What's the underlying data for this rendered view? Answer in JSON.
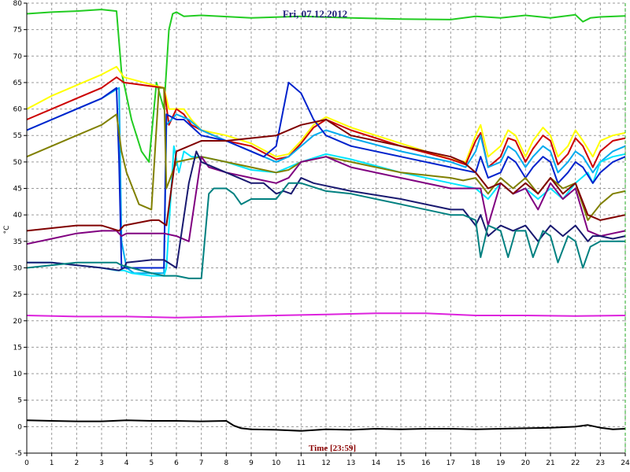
{
  "chart_data": {
    "type": "line",
    "title": "Fri, 07.12.2012",
    "xlabel": "Time [23:59]",
    "ylabel": "°C",
    "xlim": [
      0,
      24
    ],
    "ylim": [
      -5,
      80
    ],
    "x_ticks": [
      0,
      1,
      2,
      3,
      4,
      5,
      6,
      7,
      8,
      9,
      10,
      11,
      12,
      13,
      14,
      15,
      16,
      17,
      18,
      19,
      20,
      21,
      22,
      23,
      24
    ],
    "y_ticks": [
      -5,
      0,
      5,
      10,
      15,
      20,
      25,
      30,
      35,
      40,
      45,
      50,
      55,
      60,
      65,
      70,
      75,
      80
    ],
    "grid": true,
    "series": [
      {
        "color": "#22cc22",
        "x": [
          0,
          1,
          2,
          3,
          3.6,
          3.8,
          4.2,
          4.6,
          4.9,
          5.2,
          5.5,
          5.7,
          5.85,
          6,
          6.3,
          7,
          9,
          11,
          13,
          15,
          17,
          18,
          19,
          20,
          21,
          22,
          22.3,
          22.6,
          23,
          24
        ],
        "y": [
          78,
          78.3,
          78.5,
          78.8,
          78.5,
          67,
          58,
          52,
          50,
          65,
          60,
          75,
          78,
          78.3,
          77.5,
          77.7,
          77.2,
          77.5,
          77.2,
          77,
          76.9,
          77.5,
          77.2,
          77.7,
          77.2,
          77.8,
          76.5,
          77.2,
          77.4,
          77.6
        ]
      },
      {
        "color": "#ffff00",
        "x": [
          0,
          1,
          2,
          3,
          3.6,
          3.9,
          5.5,
          5.7,
          6,
          6.3,
          6.6,
          7,
          8,
          9,
          10,
          10.5,
          11,
          11.5,
          12,
          13,
          15,
          17,
          17.6,
          18,
          18.2,
          18.5,
          19,
          19.3,
          19.6,
          20,
          20.3,
          20.7,
          21,
          21.3,
          21.7,
          22,
          22.3,
          22.7,
          23,
          23.5,
          24
        ],
        "y": [
          60,
          62.5,
          64.5,
          66.5,
          68,
          66,
          64,
          60,
          60,
          60,
          58,
          56,
          55,
          53.5,
          51,
          51.5,
          54,
          57,
          58.5,
          56.5,
          53.5,
          50.5,
          50,
          55,
          57,
          51,
          53,
          56,
          55,
          51,
          54,
          56.5,
          55,
          51,
          53,
          56,
          54,
          51,
          54,
          55,
          55.5
        ]
      },
      {
        "color": "#cc0000",
        "x": [
          0,
          1,
          2,
          3,
          3.6,
          3.9,
          5.5,
          5.7,
          6,
          6.3,
          6.6,
          7,
          8,
          9,
          10,
          10.5,
          11,
          11.5,
          12,
          13,
          15,
          17,
          17.6,
          18,
          18.2,
          18.5,
          19,
          19.3,
          19.6,
          20,
          20.3,
          20.7,
          21,
          21.3,
          21.7,
          22,
          22.3,
          22.7,
          23,
          23.5,
          24
        ],
        "y": [
          58,
          60,
          62,
          64,
          66,
          65,
          64,
          57,
          60,
          59,
          57,
          56,
          54,
          53,
          50.5,
          51,
          53.5,
          56.5,
          58,
          56,
          53,
          50.5,
          49.5,
          54,
          55.5,
          49,
          51,
          54.5,
          54,
          50,
          52.5,
          55,
          54,
          49.5,
          51.5,
          54.5,
          53,
          49,
          52,
          54,
          54.5
        ]
      },
      {
        "color": "#00aaee",
        "x": [
          0,
          1,
          2,
          3,
          3.7,
          3.8,
          4,
          4.3,
          5,
          5.5,
          5.6,
          6,
          6.5,
          7,
          8,
          9,
          10,
          10.5,
          11,
          11.5,
          12,
          13,
          15,
          17,
          17.6,
          18,
          18.2,
          18.5,
          19,
          19.3,
          19.6,
          20,
          20.3,
          20.7,
          21,
          21.3,
          21.7,
          22,
          22.3,
          22.7,
          23,
          23.5,
          24
        ],
        "y": [
          56,
          58,
          60,
          62,
          64,
          35,
          30,
          29,
          29,
          29,
          57,
          59,
          58,
          56,
          54,
          52,
          50,
          51,
          53,
          55,
          56,
          54.5,
          52,
          50,
          49,
          52,
          55,
          49,
          50,
          53,
          52,
          49,
          51,
          53,
          52,
          48,
          50,
          52,
          51,
          48,
          50,
          52,
          53
        ]
      },
      {
        "color": "#00e5ff",
        "x": [
          0,
          1,
          2,
          3,
          3.6,
          3.9,
          4.2,
          5,
          5.5,
          5.6,
          5.9,
          6.1,
          6.3,
          6.6,
          7,
          8,
          9,
          10,
          11,
          12,
          13,
          15,
          17,
          18,
          18.5,
          19,
          19.5,
          20,
          20.5,
          21,
          21.5,
          22,
          22.5,
          22.7,
          23,
          23.5,
          24
        ],
        "y": [
          31,
          31,
          30.5,
          30,
          29.5,
          29.5,
          29,
          28.5,
          28.5,
          30,
          53,
          48,
          52,
          51,
          51,
          50,
          48.5,
          48,
          50,
          51.5,
          50.5,
          48,
          46,
          45,
          43,
          46,
          44,
          45,
          43,
          45,
          43,
          46,
          48,
          46,
          50,
          51,
          51.5
        ]
      },
      {
        "color": "#0022cc",
        "x": [
          0,
          1,
          2,
          3,
          3.6,
          3.7,
          3.8,
          5.5,
          5.6,
          6,
          6.3,
          7,
          8,
          9,
          9.5,
          10,
          10.5,
          11,
          11.5,
          12,
          13,
          15,
          17,
          18,
          18.2,
          18.5,
          19,
          19.3,
          19.6,
          20,
          20.3,
          20.7,
          21,
          21.3,
          21.7,
          22,
          22.3,
          22.7,
          23,
          23.5,
          24
        ],
        "y": [
          56,
          58,
          60,
          62,
          64,
          50,
          30,
          30,
          59,
          58,
          58,
          55,
          54,
          52,
          51,
          53,
          65,
          63,
          58,
          55,
          53,
          51,
          49,
          48,
          51,
          47,
          48,
          51,
          50,
          47,
          49,
          51,
          50,
          46,
          48,
          50,
          49,
          46,
          48,
          50,
          51
        ]
      },
      {
        "color": "#808000",
        "x": [
          0,
          1,
          2,
          3,
          3.6,
          3.8,
          4,
          4.5,
          5,
          5.3,
          5.5,
          5.6,
          6,
          7,
          8,
          9,
          10,
          10.5,
          11,
          12,
          13,
          15,
          17,
          17.5,
          18,
          18.5,
          19,
          19.5,
          20,
          20.5,
          21,
          21.5,
          22,
          22.5,
          23,
          23.5,
          24
        ],
        "y": [
          51,
          53,
          55,
          57,
          59,
          52,
          48,
          42,
          41,
          64,
          64,
          45,
          50,
          51,
          50,
          49,
          48,
          48.5,
          50,
          51,
          50,
          48,
          47,
          46.5,
          47,
          44,
          47,
          45,
          47,
          44,
          47,
          45,
          46,
          39,
          42,
          44,
          44.5
        ]
      },
      {
        "color": "#800080",
        "x": [
          0,
          1,
          2,
          3,
          3.6,
          3.8,
          4,
          5,
          5.5,
          6,
          6.5,
          7,
          7.3,
          8,
          9,
          10,
          10.5,
          11,
          12,
          13,
          15,
          17,
          17.8,
          18.2,
          18.5,
          19,
          19.5,
          20,
          20.5,
          21,
          21.5,
          22,
          22.5,
          23,
          23.5,
          24
        ],
        "y": [
          34.5,
          35.5,
          36.5,
          37,
          37,
          36,
          36.5,
          36.5,
          36.5,
          36,
          35,
          51,
          49,
          48,
          47,
          46,
          47,
          50,
          51,
          49,
          47,
          45,
          45,
          45,
          38,
          46,
          44,
          45,
          41,
          46,
          43,
          45,
          37,
          36,
          36.5,
          37
        ]
      },
      {
        "color": "#800000",
        "x": [
          0,
          1,
          2,
          3,
          3.7,
          3.9,
          5,
          5.3,
          5.6,
          6,
          7,
          8,
          9,
          10,
          11,
          12,
          13,
          15,
          17,
          17.5,
          18,
          18.5,
          19,
          19.5,
          20,
          20.5,
          21,
          21.5,
          22,
          22.5,
          23,
          23.5,
          24
        ],
        "y": [
          37,
          37.5,
          38,
          38,
          37,
          38,
          39,
          39,
          38,
          52,
          54,
          54,
          54.5,
          55,
          57,
          58,
          55,
          53,
          51,
          50,
          48,
          45,
          46,
          44,
          46,
          44,
          47,
          44,
          46,
          40,
          39,
          39.5,
          40
        ]
      },
      {
        "color": "#191970",
        "x": [
          0,
          1,
          2,
          3,
          3.7,
          3.9,
          4,
          5,
          5.5,
          6,
          6.5,
          6.8,
          7,
          8,
          9,
          9.5,
          10,
          10.3,
          10.6,
          11,
          11.5,
          12,
          12.5,
          13,
          15,
          17,
          17.5,
          18,
          18.2,
          18.5,
          19,
          19.5,
          20,
          20.5,
          21,
          21.5,
          22,
          22.5,
          22.7,
          23,
          23.5,
          24
        ],
        "y": [
          31,
          31,
          30.5,
          30,
          29.5,
          30,
          31,
          31.5,
          31.5,
          30,
          46,
          52,
          50,
          48,
          46,
          46,
          44,
          44.5,
          44,
          47,
          46,
          45.5,
          45,
          44.5,
          43,
          41,
          41,
          38,
          40,
          36,
          38,
          37,
          38,
          35,
          38,
          36,
          38,
          35,
          36,
          36,
          35.5,
          36
        ]
      },
      {
        "color": "#008080",
        "x": [
          0,
          1,
          2,
          3,
          3.6,
          3.8,
          4.2,
          5,
          5.5,
          6,
          6.5,
          7,
          7.3,
          7.5,
          8,
          8.3,
          8.6,
          9,
          9.5,
          10,
          10.5,
          11,
          12,
          13,
          15,
          17,
          17.5,
          18,
          18.2,
          18.5,
          19,
          19.3,
          19.6,
          20,
          20.3,
          20.7,
          21,
          21.3,
          21.7,
          22,
          22.3,
          22.6,
          23,
          23.5,
          24
        ],
        "y": [
          30,
          30.5,
          31,
          31,
          31,
          30.5,
          30,
          29,
          28.5,
          28.5,
          28,
          28,
          44,
          45,
          45,
          44,
          42,
          43,
          43,
          43,
          46,
          46,
          44.5,
          44,
          42,
          40,
          40,
          39,
          32,
          38,
          37,
          32,
          37,
          37,
          32,
          37,
          36,
          31,
          36,
          35,
          30,
          34,
          35,
          35,
          35
        ]
      },
      {
        "color": "#dd22dd",
        "x": [
          0,
          2,
          4,
          6,
          8,
          10,
          12,
          14,
          16,
          18,
          20,
          22,
          24
        ],
        "y": [
          21,
          20.8,
          20.8,
          20.6,
          20.8,
          21,
          21.2,
          21.4,
          21.4,
          21,
          21,
          20.9,
          21
        ]
      },
      {
        "color": "#000000",
        "x": [
          0,
          1,
          2,
          3,
          4,
          5,
          6,
          7,
          8,
          8.3,
          8.6,
          9,
          10,
          11,
          12,
          13,
          14,
          15,
          16,
          17,
          18,
          19,
          20,
          21,
          22,
          22.5,
          23,
          23.5,
          24
        ],
        "y": [
          1.2,
          1.1,
          1,
          1,
          1.2,
          1.1,
          1.1,
          1,
          1.1,
          0.2,
          -0.3,
          -0.5,
          -0.6,
          -0.8,
          -0.5,
          -0.6,
          -0.4,
          -0.5,
          -0.4,
          -0.4,
          -0.5,
          -0.4,
          -0.3,
          -0.2,
          0,
          0.3,
          -0.2,
          -0.5,
          -0.4
        ]
      }
    ]
  }
}
